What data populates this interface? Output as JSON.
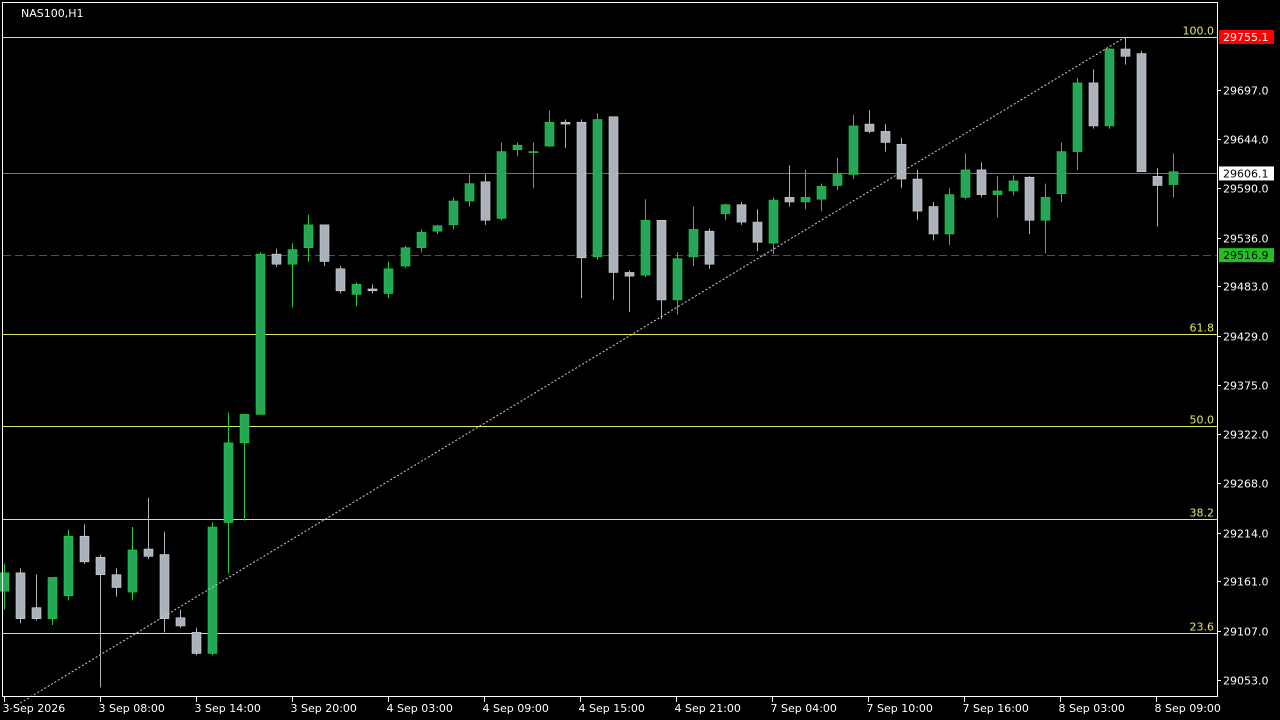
{
  "colors": {
    "background": "#000000",
    "axis": "#ffffff",
    "bull_body": "#26a65b",
    "bear_body": "#a9b1bb",
    "fib_line": "#e6e65c",
    "level_line": "#008c00",
    "bid_line": "#6b7280",
    "bid_badge": "#ffffff",
    "ask_badge": "#ff0000",
    "level_badge": "#22c022",
    "trendline": "#cfcfcf"
  },
  "chart_data": {
    "type": "candlestick",
    "symbol_label": "NAS100,H1",
    "y_ticks": [
      29697.0,
      29644.0,
      29590.0,
      29536.0,
      29483.0,
      29429.0,
      29375.0,
      29322.0,
      29268.0,
      29214.0,
      29161.0,
      29107.0,
      29053.0
    ],
    "x_ticks": [
      "3 Sep 2026",
      "3 Sep 08:00",
      "3 Sep 14:00",
      "3 Sep 20:00",
      "4 Sep 03:00",
      "4 Sep 09:00",
      "4 Sep 15:00",
      "4 Sep 21:00",
      "7 Sep 04:00",
      "7 Sep 10:00",
      "7 Sep 16:00",
      "8 Sep 03:00",
      "8 Sep 09:00"
    ],
    "price_badges": [
      {
        "name": "ask",
        "value": "29755.1",
        "price": 29755.1
      },
      {
        "name": "bid",
        "value": "29606.1",
        "price": 29606.1
      },
      {
        "name": "horizontal-level",
        "value": "29516.9",
        "price": 29516.9
      }
    ],
    "fibonacci": {
      "low": 29032.0,
      "high": 29755.1,
      "levels": [
        {
          "label": "100.0",
          "price": 29755.1
        },
        {
          "label": "61.8",
          "price": 29431.2
        },
        {
          "label": "50.0",
          "price": 29330.0
        },
        {
          "label": "38.2",
          "price": 29229.0
        },
        {
          "label": "23.6",
          "price": 29104.6
        }
      ]
    },
    "trendline": {
      "from_bar": 0,
      "from_price": 29032.0,
      "to_bar": 70,
      "to_price": 29755.1
    },
    "candles": [
      {
        "o": 29150,
        "h": 29180,
        "l": 29130,
        "c": 29170
      },
      {
        "o": 29170,
        "h": 29175,
        "l": 29115,
        "c": 29120
      },
      {
        "o": 29132,
        "h": 29168,
        "l": 29118,
        "c": 29120
      },
      {
        "o": 29120,
        "h": 29165,
        "l": 29113,
        "c": 29165
      },
      {
        "o": 29145,
        "h": 29217,
        "l": 29140,
        "c": 29210
      },
      {
        "o": 29210,
        "h": 29223,
        "l": 29180,
        "c": 29182
      },
      {
        "o": 29187,
        "h": 29190,
        "l": 29045,
        "c": 29168
      },
      {
        "o": 29168,
        "h": 29175,
        "l": 29144,
        "c": 29154
      },
      {
        "o": 29149,
        "h": 29220,
        "l": 29140,
        "c": 29195
      },
      {
        "o": 29196,
        "h": 29252,
        "l": 29185,
        "c": 29188
      },
      {
        "o": 29190,
        "h": 29215,
        "l": 29105,
        "c": 29120
      },
      {
        "o": 29121,
        "h": 29130,
        "l": 29110,
        "c": 29112
      },
      {
        "o": 29105,
        "h": 29110,
        "l": 29080,
        "c": 29082
      },
      {
        "o": 29082,
        "h": 29225,
        "l": 29080,
        "c": 29220
      },
      {
        "o": 29225,
        "h": 29345,
        "l": 29170,
        "c": 29312
      },
      {
        "o": 29312,
        "h": 29343,
        "l": 29227,
        "c": 29343
      },
      {
        "o": 29343,
        "h": 29520,
        "l": 29343,
        "c": 29518
      },
      {
        "o": 29518,
        "h": 29524,
        "l": 29504,
        "c": 29507
      },
      {
        "o": 29507,
        "h": 29530,
        "l": 29460,
        "c": 29523
      },
      {
        "o": 29525,
        "h": 29561,
        "l": 29510,
        "c": 29550
      },
      {
        "o": 29550,
        "h": 29550,
        "l": 29505,
        "c": 29510
      },
      {
        "o": 29502,
        "h": 29505,
        "l": 29475,
        "c": 29478
      },
      {
        "o": 29474,
        "h": 29487,
        "l": 29461,
        "c": 29485
      },
      {
        "o": 29480,
        "h": 29485,
        "l": 29475,
        "c": 29478
      },
      {
        "o": 29475,
        "h": 29510,
        "l": 29470,
        "c": 29502
      },
      {
        "o": 29505,
        "h": 29527,
        "l": 29503,
        "c": 29525
      },
      {
        "o": 29525,
        "h": 29545,
        "l": 29520,
        "c": 29542
      },
      {
        "o": 29543,
        "h": 29550,
        "l": 29540,
        "c": 29549
      },
      {
        "o": 29550,
        "h": 29580,
        "l": 29545,
        "c": 29576
      },
      {
        "o": 29576,
        "h": 29605,
        "l": 29570,
        "c": 29595
      },
      {
        "o": 29597,
        "h": 29605,
        "l": 29550,
        "c": 29555
      },
      {
        "o": 29557,
        "h": 29640,
        "l": 29555,
        "c": 29630
      },
      {
        "o": 29632,
        "h": 29640,
        "l": 29625,
        "c": 29637
      },
      {
        "o": 29630,
        "h": 29640,
        "l": 29590,
        "c": 29630
      },
      {
        "o": 29636,
        "h": 29675,
        "l": 29635,
        "c": 29662
      },
      {
        "o": 29662,
        "h": 29665,
        "l": 29634,
        "c": 29660
      },
      {
        "o": 29662,
        "h": 29665,
        "l": 29470,
        "c": 29514
      },
      {
        "o": 29515,
        "h": 29672,
        "l": 29512,
        "c": 29665
      },
      {
        "o": 29668,
        "h": 29668,
        "l": 29468,
        "c": 29498
      },
      {
        "o": 29498,
        "h": 29500,
        "l": 29455,
        "c": 29494
      },
      {
        "o": 29495,
        "h": 29578,
        "l": 29493,
        "c": 29555
      },
      {
        "o": 29555,
        "h": 29555,
        "l": 29447,
        "c": 29468
      },
      {
        "o": 29468,
        "h": 29520,
        "l": 29452,
        "c": 29513
      },
      {
        "o": 29515,
        "h": 29570,
        "l": 29505,
        "c": 29545
      },
      {
        "o": 29543,
        "h": 29546,
        "l": 29502,
        "c": 29507
      },
      {
        "o": 29562,
        "h": 29573,
        "l": 29555,
        "c": 29572
      },
      {
        "o": 29572,
        "h": 29575,
        "l": 29550,
        "c": 29553
      },
      {
        "o": 29553,
        "h": 29567,
        "l": 29521,
        "c": 29531
      },
      {
        "o": 29530,
        "h": 29580,
        "l": 29518,
        "c": 29577
      },
      {
        "o": 29580,
        "h": 29615,
        "l": 29570,
        "c": 29575
      },
      {
        "o": 29575,
        "h": 29610,
        "l": 29567,
        "c": 29580
      },
      {
        "o": 29578,
        "h": 29595,
        "l": 29565,
        "c": 29592
      },
      {
        "o": 29593,
        "h": 29623,
        "l": 29588,
        "c": 29605
      },
      {
        "o": 29605,
        "h": 29670,
        "l": 29600,
        "c": 29658
      },
      {
        "o": 29660,
        "h": 29675,
        "l": 29650,
        "c": 29652
      },
      {
        "o": 29652,
        "h": 29660,
        "l": 29630,
        "c": 29640
      },
      {
        "o": 29638,
        "h": 29645,
        "l": 29590,
        "c": 29600
      },
      {
        "o": 29600,
        "h": 29610,
        "l": 29555,
        "c": 29565
      },
      {
        "o": 29570,
        "h": 29575,
        "l": 29533,
        "c": 29540
      },
      {
        "o": 29540,
        "h": 29590,
        "l": 29528,
        "c": 29583
      },
      {
        "o": 29580,
        "h": 29628,
        "l": 29578,
        "c": 29610
      },
      {
        "o": 29610,
        "h": 29618,
        "l": 29580,
        "c": 29583
      },
      {
        "o": 29583,
        "h": 29603,
        "l": 29558,
        "c": 29587
      },
      {
        "o": 29587,
        "h": 29604,
        "l": 29582,
        "c": 29598
      },
      {
        "o": 29602,
        "h": 29603,
        "l": 29540,
        "c": 29555
      },
      {
        "o": 29555,
        "h": 29595,
        "l": 29519,
        "c": 29580
      },
      {
        "o": 29584,
        "h": 29640,
        "l": 29575,
        "c": 29630
      },
      {
        "o": 29630,
        "h": 29710,
        "l": 29610,
        "c": 29705
      },
      {
        "o": 29705,
        "h": 29720,
        "l": 29655,
        "c": 29658
      },
      {
        "o": 29658,
        "h": 29743,
        "l": 29655,
        "c": 29742
      },
      {
        "o": 29742,
        "h": 29755,
        "l": 29725,
        "c": 29734
      },
      {
        "o": 29737,
        "h": 29740,
        "l": 29608,
        "c": 29608
      },
      {
        "o": 29603,
        "h": 29612,
        "l": 29548,
        "c": 29593
      },
      {
        "o": 29594,
        "h": 29628,
        "l": 29580,
        "c": 29608
      }
    ]
  }
}
